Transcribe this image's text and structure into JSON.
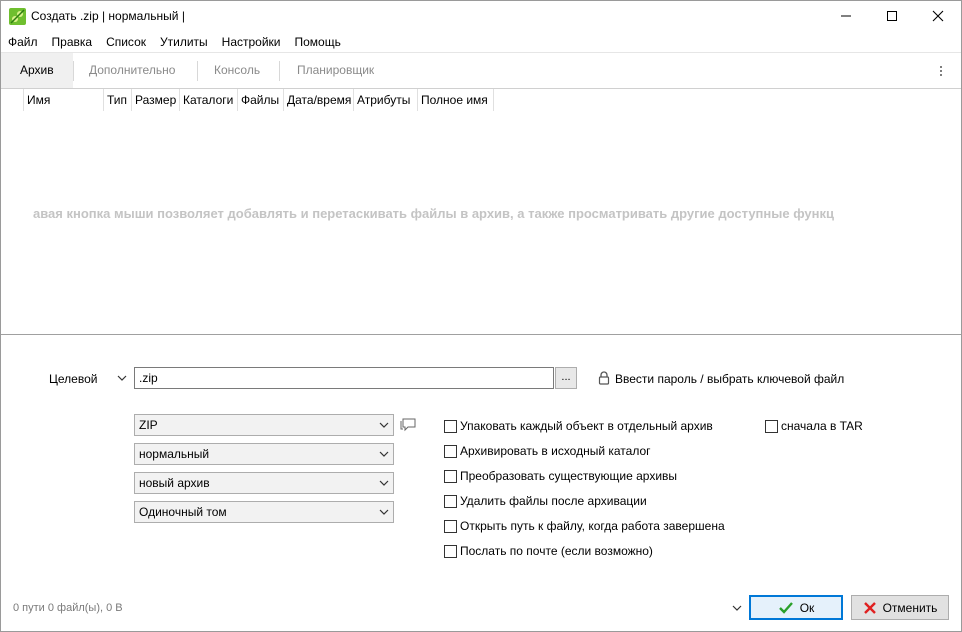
{
  "window": {
    "title": "Создать .zip | нормальный |",
    "accent": "#0078d7"
  },
  "menu": [
    "Файл",
    "Правка",
    "Список",
    "Утилиты",
    "Настройки",
    "Помощь"
  ],
  "tabs": [
    {
      "label": "Архив",
      "active": true
    },
    {
      "label": "Дополнительно",
      "active": false
    },
    {
      "label": "Консоль",
      "active": false
    },
    {
      "label": "Планировщик",
      "active": false
    }
  ],
  "filelist": {
    "columns": [
      "Имя",
      "Тип",
      "Размер",
      "Каталоги",
      "Файлы",
      "Дата/время",
      "Атрибуты",
      "Полное имя"
    ],
    "hint": "авая кнопка мыши позволяет добавлять и перетаскивать файлы в архив, а также просматривать другие доступные функц"
  },
  "target": {
    "label": "Целевой",
    "value": ".zip",
    "browse_label": "...",
    "password_label": "Ввести пароль / выбрать ключевой файл"
  },
  "selects": {
    "format": "ZIP",
    "compression": "нормальный",
    "mode": "новый архив",
    "volume": "Одиночный том"
  },
  "options": [
    {
      "label": "Упаковать каждый объект в отдельный архив",
      "checked": false
    },
    {
      "label": "Архивировать в исходный каталог",
      "checked": false
    },
    {
      "label": "Преобразовать существующие архивы",
      "checked": false
    },
    {
      "label": "Удалить файлы после архивации",
      "checked": false
    },
    {
      "label": "Открыть путь к файлу, когда работа завершена",
      "checked": false
    },
    {
      "label": "Послать по почте (если возможно)",
      "checked": false
    }
  ],
  "tar_option": {
    "label": "сначала в TAR",
    "checked": false
  },
  "status": "0 пути 0 файл(ы), 0 B",
  "buttons": {
    "ok": "Ок",
    "cancel": "Отменить"
  },
  "icons": {
    "app": "peazip-icon",
    "lock": "lock-icon",
    "comment": "comment-icon",
    "ok": "checkmark-icon",
    "cancel": "x-icon"
  }
}
